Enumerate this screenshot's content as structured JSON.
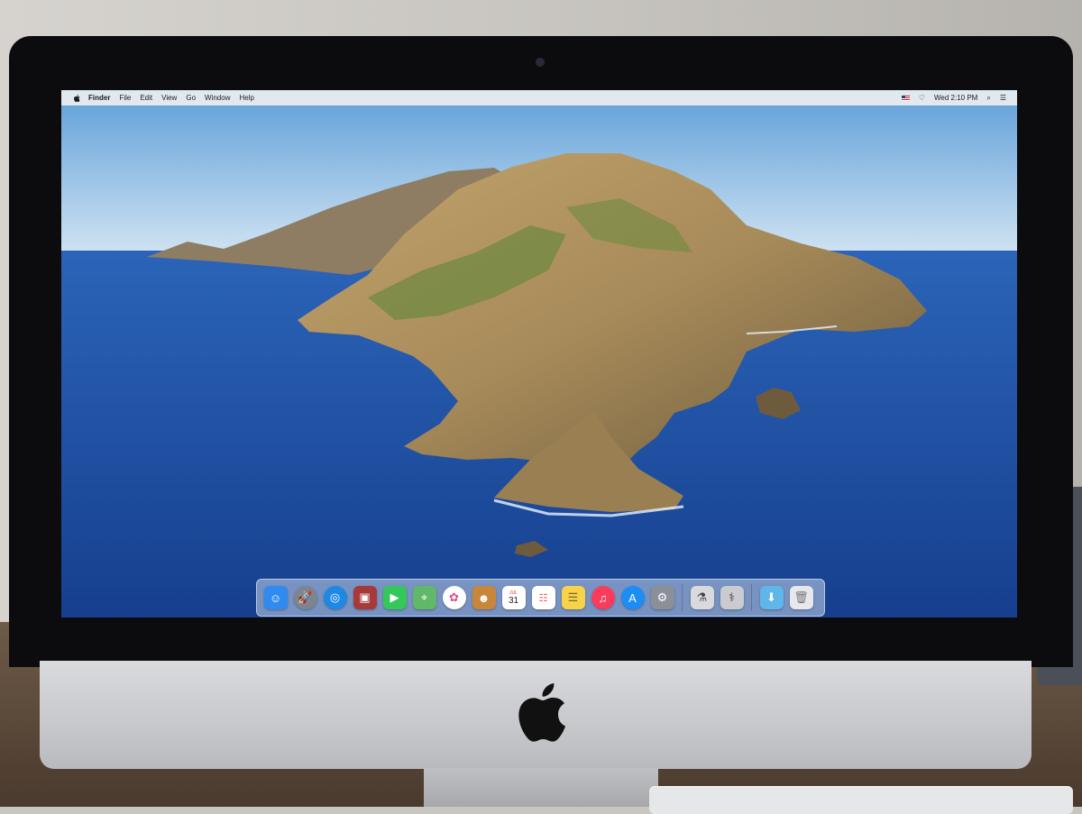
{
  "menubar": {
    "apple_icon": "apple-icon",
    "app_name": "Finder",
    "items": [
      "File",
      "Edit",
      "View",
      "Go",
      "Window",
      "Help"
    ],
    "clock": "Wed 2:10 PM"
  },
  "dock": {
    "apps": [
      {
        "icon": "finder-icon",
        "color": "#2f8bf0"
      },
      {
        "icon": "launchpad-icon",
        "color": "#7d8591"
      },
      {
        "icon": "safari-icon",
        "color": "#1e88e5"
      },
      {
        "icon": "photo-booth-icon",
        "color": "#a63a3a"
      },
      {
        "icon": "facetime-icon",
        "color": "#34c759"
      },
      {
        "icon": "maps-icon",
        "color": "#62b86a"
      },
      {
        "icon": "photos-icon",
        "color": "#ffffff"
      },
      {
        "icon": "contacts-icon",
        "color": "#c8863b"
      },
      {
        "icon": "calendar-icon",
        "color": "#ffffff"
      },
      {
        "icon": "reminders-icon",
        "color": "#ffffff"
      },
      {
        "icon": "notes-icon",
        "color": "#f7d24a"
      },
      {
        "icon": "music-icon",
        "color": "#fa3b5c"
      },
      {
        "icon": "app-store-icon",
        "color": "#1c8df5"
      },
      {
        "icon": "system-preferences-icon",
        "color": "#8a8f98"
      }
    ],
    "utilities": [
      {
        "icon": "network-utility-icon",
        "color": "#d9dadd"
      },
      {
        "icon": "disk-utility-icon",
        "color": "#c9cbd0"
      }
    ],
    "folders": [
      {
        "icon": "downloads-folder-icon",
        "color": "#5fb6e8"
      },
      {
        "icon": "trash-icon",
        "color": "#e6e8ec"
      }
    ],
    "calendar_day": "31",
    "calendar_month": "JUL"
  },
  "colors": {
    "sky": "#7fb6e6",
    "ocean": "#1f4f9c",
    "bezel": "#0c0c0f",
    "chin": "#cfd0d3"
  }
}
